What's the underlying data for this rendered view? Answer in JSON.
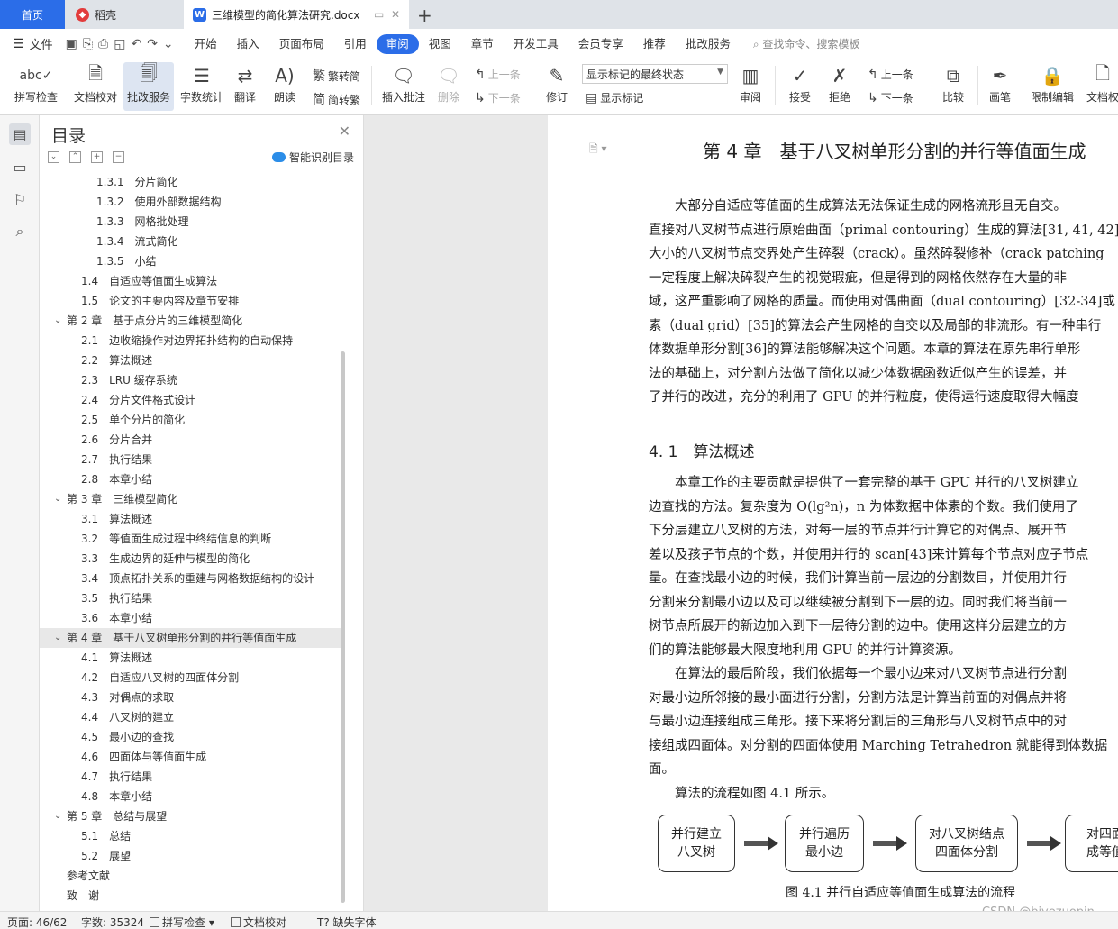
{
  "tabs": {
    "home": "首页",
    "daoke": "稻壳",
    "doc": "三维模型的简化算法研究.docx"
  },
  "menu": {
    "file": "文件",
    "tabs": [
      "开始",
      "插入",
      "页面布局",
      "引用",
      "审阅",
      "视图",
      "章节",
      "开发工具",
      "会员专享",
      "推荐",
      "批改服务"
    ],
    "active_tab": "审阅",
    "search": "查找命令、搜索模板"
  },
  "ribbon": {
    "spell": "拼写检查",
    "proof": "文档校对",
    "correct": "批改服务",
    "wordcount": "字数统计",
    "translate": "翻译",
    "read": "朗读",
    "trad": "繁转简",
    "simp": "简转繁",
    "insert_comment": "插入批注",
    "delete": "删除",
    "prev_comment": "上一条",
    "next_comment": "下一条",
    "track": "修订",
    "markup_state": "显示标记的最终状态",
    "show_markup": "显示标记",
    "review": "审阅",
    "accept": "接受",
    "reject": "拒绝",
    "prev_change": "上一条",
    "next_change": "下一条",
    "compare": "比较",
    "pen": "画笔",
    "restrict": "限制编辑",
    "doc_perm": "文档权"
  },
  "nav": {
    "title": "目录",
    "smart": "智能识别目录",
    "toc": [
      {
        "text": "1.3.1　分片简化",
        "level": 3
      },
      {
        "text": "1.3.2　使用外部数据结构",
        "level": 3
      },
      {
        "text": "1.3.3　网格批处理",
        "level": 3
      },
      {
        "text": "1.3.4　流式简化",
        "level": 3
      },
      {
        "text": "1.3.5　小结",
        "level": 3
      },
      {
        "text": "1.4　自适应等值面生成算法",
        "level": 2
      },
      {
        "text": "1.5　论文的主要内容及章节安排",
        "level": 2
      },
      {
        "text": "第 2 章　基于点分片的三维模型简化",
        "level": 1,
        "expandable": true
      },
      {
        "text": "2.1　边收缩操作对边界拓扑结构的自动保持",
        "level": 2
      },
      {
        "text": "2.2　算法概述",
        "level": 2
      },
      {
        "text": "2.3　LRU 缓存系统",
        "level": 2
      },
      {
        "text": "2.4　分片文件格式设计",
        "level": 2
      },
      {
        "text": "2.5　单个分片的简化",
        "level": 2
      },
      {
        "text": "2.6　分片合并",
        "level": 2
      },
      {
        "text": "2.7　执行结果",
        "level": 2
      },
      {
        "text": "2.8　本章小结",
        "level": 2
      },
      {
        "text": "第 3 章　三维模型简化",
        "level": 1,
        "expandable": true
      },
      {
        "text": "3.1　算法概述",
        "level": 2
      },
      {
        "text": "3.2　等值面生成过程中终结信息的判断",
        "level": 2
      },
      {
        "text": "3.3　生成边界的延伸与模型的简化",
        "level": 2
      },
      {
        "text": "3.4　顶点拓扑关系的重建与网格数据结构的设计",
        "level": 2
      },
      {
        "text": "3.5　执行结果",
        "level": 2
      },
      {
        "text": "3.6　本章小结",
        "level": 2
      },
      {
        "text": "第 4 章　基于八叉树单形分割的并行等值面生成",
        "level": 1,
        "expandable": true,
        "selected": true
      },
      {
        "text": "4.1　算法概述",
        "level": 2
      },
      {
        "text": "4.2　自适应八叉树的四面体分割",
        "level": 2
      },
      {
        "text": "4.3　对偶点的求取",
        "level": 2
      },
      {
        "text": "4.4　八叉树的建立",
        "level": 2
      },
      {
        "text": "4.5　最小边的查找",
        "level": 2
      },
      {
        "text": "4.6　四面体与等值面生成",
        "level": 2
      },
      {
        "text": "4.7　执行结果",
        "level": 2
      },
      {
        "text": "4.8　本章小结",
        "level": 2
      },
      {
        "text": "第 5 章　总结与展望",
        "level": 1,
        "expandable": true
      },
      {
        "text": "5.1　总结",
        "level": 2
      },
      {
        "text": "5.2　展望",
        "level": 2
      },
      {
        "text": "参考文献",
        "level": 1
      },
      {
        "text": "致　谢",
        "level": 1
      }
    ]
  },
  "document": {
    "chapter_title": "第 4 章　基于八叉树单形分割的并行等值面生成",
    "para1": [
      "　　大部分自适应等值面的生成算法无法保证生成的网格流形且无自交。",
      "直接对八叉树节点进行原始曲面（primal contouring）生成的算法[31, 41, 42]会",
      "大小的八叉树节点交界处产生碎裂（crack）。虽然碎裂修补（crack patching",
      "一定程度上解决碎裂产生的视觉瑕疵，但是得到的网格依然存在大量的非",
      "域，这严重影响了网格的质量。而使用对偶曲面（dual contouring）[32-34]或",
      "素（dual grid）[35]的算法会产生网格的自交以及局部的非流形。有一种串行",
      "体数据单形分割[36]的算法能够解决这个问题。本章的算法在原先串行单形",
      "法的基础上，对分割方法做了简化以减少体数据函数近似产生的误差，并",
      "了并行的改进，充分的利用了 GPU 的并行粒度，使得运行速度取得大幅度"
    ],
    "section_title": "4. 1　算法概述",
    "para2": [
      "　　本章工作的主要贡献是提供了一套完整的基于 GPU 并行的八叉树建立",
      "边查找的方法。复杂度为 O(lg²n)，n 为体数据中体素的个数。我们使用了",
      "下分层建立八叉树的方法，对每一层的节点并行计算它的对偶点、展开节",
      "差以及孩子节点的个数，并使用并行的 scan[43]来计算每个节点对应子节点",
      "量。在查找最小边的时候，我们计算当前一层边的分割数目，并使用并行",
      "分割来分割最小边以及可以继续被分割到下一层的边。同时我们将当前一",
      "树节点所展开的新边加入到下一层待分割的边中。使用这样分层建立的方",
      "们的算法能够最大限度地利用 GPU 的并行计算资源。",
      "　　在算法的最后阶段，我们依据每一个最小边来对八叉树节点进行分割",
      "对最小边所邻接的最小面进行分割，分割方法是计算当前面的对偶点并将",
      "与最小边连接组成三角形。接下来将分割后的三角形与八叉树节点中的对",
      "接组成四面体。对分割的四面体使用 Marching Tetrahedron 就能得到体数据",
      "面。",
      "　　算法的流程如图 4.1 所示。"
    ],
    "flow": [
      "并行建立\n八叉树",
      "并行遍历\n最小边",
      "对八叉树结点\n四面体分割",
      "对四面\n成等值"
    ],
    "figure_caption": "图 4.1  并行自适应等值面生成算法的流程"
  },
  "status": {
    "page": "页面: 46/62",
    "words": "字数: 35324",
    "spell": "拼写检查",
    "proof": "文档校对",
    "missing_font": "缺失字体"
  },
  "watermark": "CSDN @biyezuopin"
}
